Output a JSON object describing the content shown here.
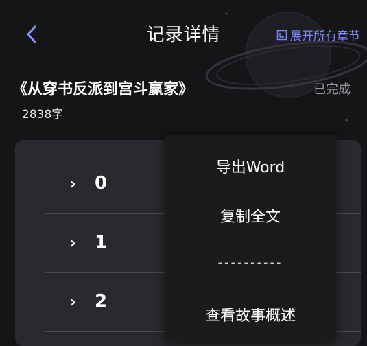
{
  "header": {
    "title": "记录详情",
    "expand_all": "展开所有章节"
  },
  "book": {
    "title": "《从穿书反派到宫斗赢家》",
    "status": "已完成",
    "word_count": "2838字"
  },
  "chapters": [
    {
      "number": "0"
    },
    {
      "number": "1"
    },
    {
      "number": "2"
    }
  ],
  "menu": {
    "export_word": "导出Word",
    "copy_all": "复制全文",
    "separator": "----------",
    "view_summary": "查看故事概述"
  },
  "colors": {
    "background": "#151518",
    "card": "#2a2a2e",
    "accent": "#7b86ff",
    "back_arrow": "#8a95ff",
    "muted_text": "#9a9a9f"
  }
}
